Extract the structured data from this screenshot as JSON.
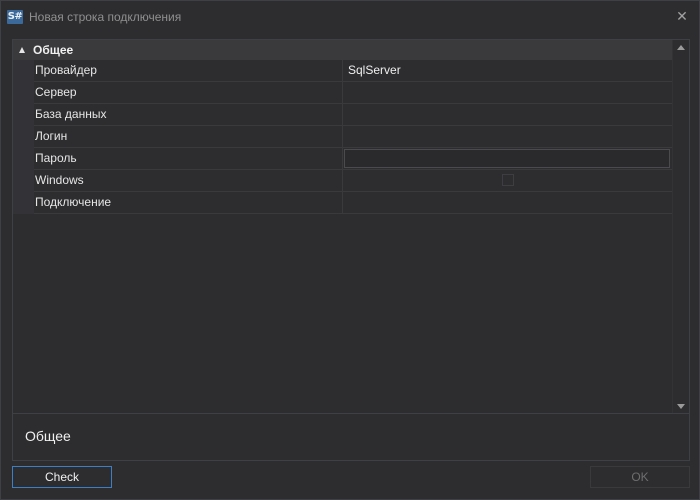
{
  "window": {
    "title": "Новая строка подключения",
    "app_icon_text": "S#"
  },
  "property_grid": {
    "category": "Общее",
    "rows": [
      {
        "name": "Провайдер",
        "value": "SqlServer"
      },
      {
        "name": "Сервер",
        "value": ""
      },
      {
        "name": "База данных",
        "value": ""
      },
      {
        "name": "Логин",
        "value": ""
      },
      {
        "name": "Пароль",
        "value": ""
      },
      {
        "name": "Windows",
        "value": ""
      },
      {
        "name": "Подключение",
        "value": ""
      }
    ],
    "windows_checked": false
  },
  "description": {
    "title": "Общее"
  },
  "buttons": {
    "check_label": "Check",
    "ok_label": "OK"
  },
  "colors": {
    "accent": "#3e7fc4",
    "background": "#2d2d30"
  }
}
